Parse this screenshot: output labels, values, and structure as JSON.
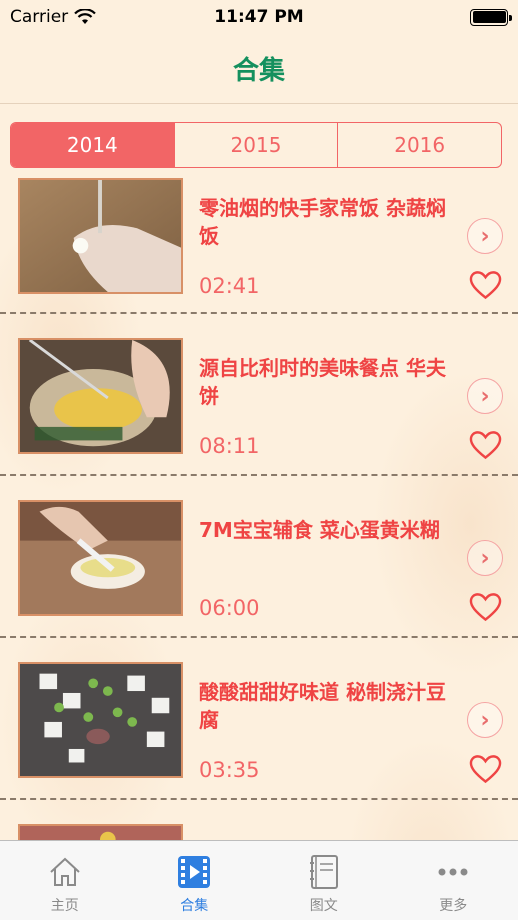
{
  "status_bar": {
    "carrier": "Carrier",
    "time": "11:47 PM"
  },
  "nav": {
    "title": "合集"
  },
  "segments": [
    {
      "label": "2014",
      "selected": true
    },
    {
      "label": "2015",
      "selected": false
    },
    {
      "label": "2016",
      "selected": false
    }
  ],
  "videos": [
    {
      "title": "零油烟的快手家常饭 杂蔬焖饭",
      "duration": "02:41",
      "thumbnail": "cutting-board-hand"
    },
    {
      "title": "源自比利时的美味餐点 华夫饼",
      "duration": "08:11",
      "thumbnail": "whisk-eggs-bowl"
    },
    {
      "title": "7M宝宝辅食 菜心蛋黄米糊",
      "duration": "06:00",
      "thumbnail": "spoon-cup"
    },
    {
      "title": "酸酸甜甜好味道 秘制浇汁豆腐",
      "duration": "03:35",
      "thumbnail": "tofu-peas-pan"
    }
  ],
  "tabs": [
    {
      "label": "主页",
      "icon": "house-icon",
      "active": false
    },
    {
      "label": "合集",
      "icon": "film-icon",
      "active": true
    },
    {
      "label": "图文",
      "icon": "notebook-icon",
      "active": false
    },
    {
      "label": "更多",
      "icon": "more-dots-icon",
      "active": false
    }
  ],
  "colors": {
    "accent": "#f26566",
    "title_green": "#14905e",
    "tab_active": "#2f7fe0",
    "background": "#fdf0de"
  }
}
